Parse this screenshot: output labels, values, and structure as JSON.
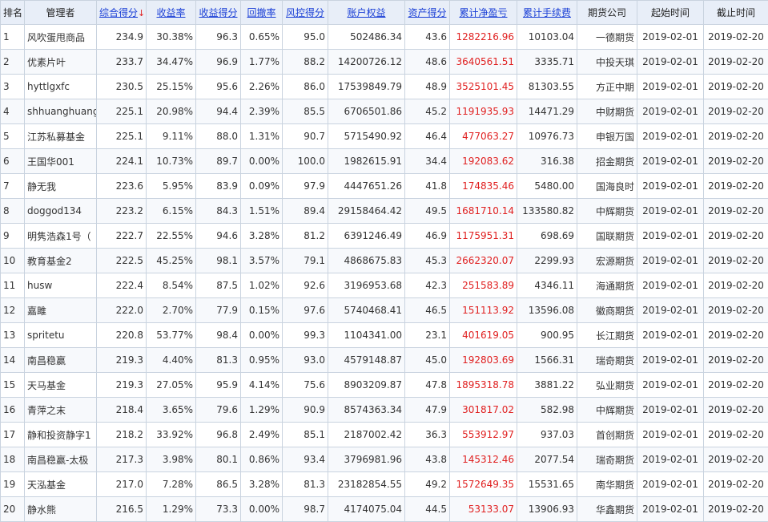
{
  "header": {
    "rank": "排名",
    "manager": "管理者",
    "composite": "综合得分",
    "sort_indicator": "↓",
    "return_rate": "收益率",
    "return_score": "收益得分",
    "drawdown": "回撤率",
    "risk_score": "风控得分",
    "equity": "账户权益",
    "asset_score": "资产得分",
    "net_profit": "累计净盈亏",
    "fee": "累计手续费",
    "company": "期货公司",
    "start": "起始时间",
    "end": "截止时间"
  },
  "rows": [
    [
      "1",
      "风吹蛋甩商品",
      "234.9",
      "30.38%",
      "96.3",
      "0.65%",
      "95.0",
      "502486.34",
      "43.6",
      "1282216.96",
      "10103.04",
      "一德期货",
      "2019-02-01",
      "2019-02-20"
    ],
    [
      "2",
      "优素片叶",
      "233.7",
      "34.47%",
      "96.9",
      "1.77%",
      "88.2",
      "14200726.12",
      "48.6",
      "3640561.51",
      "3335.71",
      "中投天琪",
      "2019-02-01",
      "2019-02-20"
    ],
    [
      "3",
      "hyttlgxfc",
      "230.5",
      "25.15%",
      "95.6",
      "2.26%",
      "86.0",
      "17539849.79",
      "48.9",
      "3525101.45",
      "81303.55",
      "方正中期",
      "2019-02-01",
      "2019-02-20"
    ],
    [
      "4",
      "shhuanghuang",
      "225.1",
      "20.98%",
      "94.4",
      "2.39%",
      "85.5",
      "6706501.86",
      "45.2",
      "1191935.93",
      "14471.29",
      "中财期货",
      "2019-02-01",
      "2019-02-20"
    ],
    [
      "5",
      "江苏私募基金",
      "225.1",
      "9.11%",
      "88.0",
      "1.31%",
      "90.7",
      "5715490.92",
      "46.4",
      "477063.27",
      "10976.73",
      "申银万国",
      "2019-02-01",
      "2019-02-20"
    ],
    [
      "6",
      "王国华001",
      "224.1",
      "10.73%",
      "89.7",
      "0.00%",
      "100.0",
      "1982615.91",
      "34.4",
      "192083.62",
      "316.38",
      "招金期货",
      "2019-02-01",
      "2019-02-20"
    ],
    [
      "7",
      "静无我",
      "223.6",
      "5.95%",
      "83.9",
      "0.09%",
      "97.9",
      "4447651.26",
      "41.8",
      "174835.46",
      "5480.00",
      "国海良时",
      "2019-02-01",
      "2019-02-20"
    ],
    [
      "8",
      "doggod134",
      "223.2",
      "6.15%",
      "84.3",
      "1.51%",
      "89.4",
      "29158464.42",
      "49.5",
      "1681710.14",
      "133580.82",
      "中辉期货",
      "2019-02-01",
      "2019-02-20"
    ],
    [
      "9",
      "明隽浩森1号（",
      "222.7",
      "22.55%",
      "94.6",
      "3.28%",
      "81.2",
      "6391246.49",
      "46.9",
      "1175951.31",
      "698.69",
      "国联期货",
      "2019-02-01",
      "2019-02-20"
    ],
    [
      "10",
      "教育基金2",
      "222.5",
      "45.25%",
      "98.1",
      "3.57%",
      "79.1",
      "4868675.83",
      "45.3",
      "2662320.07",
      "2299.93",
      "宏源期货",
      "2019-02-01",
      "2019-02-20"
    ],
    [
      "11",
      "husw",
      "222.4",
      "8.54%",
      "87.5",
      "1.02%",
      "92.6",
      "3196953.68",
      "42.3",
      "251583.89",
      "4346.11",
      "海通期货",
      "2019-02-01",
      "2019-02-20"
    ],
    [
      "12",
      "嘉雎",
      "222.0",
      "2.70%",
      "77.9",
      "0.15%",
      "97.6",
      "5740468.41",
      "46.5",
      "151113.92",
      "13596.08",
      "徽商期货",
      "2019-02-01",
      "2019-02-20"
    ],
    [
      "13",
      "spritetu",
      "220.8",
      "53.77%",
      "98.4",
      "0.00%",
      "99.3",
      "1104341.00",
      "23.1",
      "401619.05",
      "900.95",
      "长江期货",
      "2019-02-01",
      "2019-02-20"
    ],
    [
      "14",
      "南昌稳赢",
      "219.3",
      "4.40%",
      "81.3",
      "0.95%",
      "93.0",
      "4579148.87",
      "45.0",
      "192803.69",
      "1566.31",
      "瑞奇期货",
      "2019-02-01",
      "2019-02-20"
    ],
    [
      "15",
      "天马基金",
      "219.3",
      "27.05%",
      "95.9",
      "4.14%",
      "75.6",
      "8903209.87",
      "47.8",
      "1895318.78",
      "3881.22",
      "弘业期货",
      "2019-02-01",
      "2019-02-20"
    ],
    [
      "16",
      "青萍之末",
      "218.4",
      "3.65%",
      "79.6",
      "1.29%",
      "90.9",
      "8574363.34",
      "47.9",
      "301817.02",
      "582.98",
      "中辉期货",
      "2019-02-01",
      "2019-02-20"
    ],
    [
      "17",
      "静和投资静字1",
      "218.2",
      "33.92%",
      "96.8",
      "2.49%",
      "85.1",
      "2187002.42",
      "36.3",
      "553912.97",
      "937.03",
      "首创期货",
      "2019-02-01",
      "2019-02-20"
    ],
    [
      "18",
      "南昌稳赢-太极",
      "217.3",
      "3.98%",
      "80.1",
      "0.86%",
      "93.4",
      "3796981.96",
      "43.8",
      "145312.46",
      "2077.54",
      "瑞奇期货",
      "2019-02-01",
      "2019-02-20"
    ],
    [
      "19",
      "天泓基金",
      "217.0",
      "7.28%",
      "86.5",
      "3.28%",
      "81.3",
      "23182854.55",
      "49.2",
      "1572649.35",
      "15531.65",
      "南华期货",
      "2019-02-01",
      "2019-02-20"
    ],
    [
      "20",
      "静水熊",
      "216.5",
      "1.29%",
      "73.3",
      "0.00%",
      "98.7",
      "4174075.04",
      "44.5",
      "53133.07",
      "13906.93",
      "华鑫期货",
      "2019-02-01",
      "2019-02-20"
    ]
  ],
  "colors": {
    "header_bg": "#e8eef8",
    "link": "#1a3fd6",
    "profit": "#e02020",
    "border": "#c9d3df"
  }
}
